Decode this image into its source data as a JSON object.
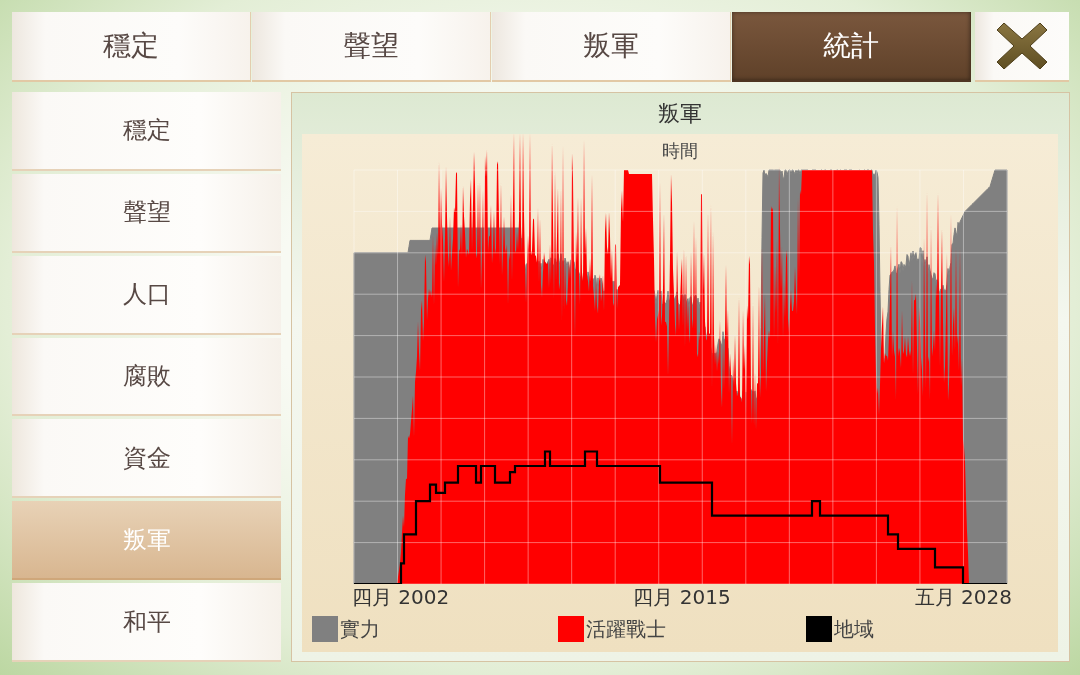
{
  "tabs": [
    {
      "label": "穩定",
      "selected": false
    },
    {
      "label": "聲望",
      "selected": false
    },
    {
      "label": "叛軍",
      "selected": false
    },
    {
      "label": "統計",
      "selected": true
    }
  ],
  "sidebar": {
    "items": [
      {
        "label": "穩定",
        "selected": false
      },
      {
        "label": "聲望",
        "selected": false
      },
      {
        "label": "人口",
        "selected": false
      },
      {
        "label": "腐敗",
        "selected": false
      },
      {
        "label": "資金",
        "selected": false
      },
      {
        "label": "叛軍",
        "selected": true
      },
      {
        "label": "和平",
        "selected": false
      }
    ]
  },
  "chart": {
    "title": "叛軍",
    "xlabel": "時間",
    "x_labels": [
      "四月 2002",
      "四月 2015",
      "五月 2028"
    ],
    "legend": [
      {
        "label": "實力",
        "color": "#808080"
      },
      {
        "label": "活躍戰士",
        "color": "#ff0000"
      },
      {
        "label": "地域",
        "color": "#000000"
      }
    ]
  }
}
